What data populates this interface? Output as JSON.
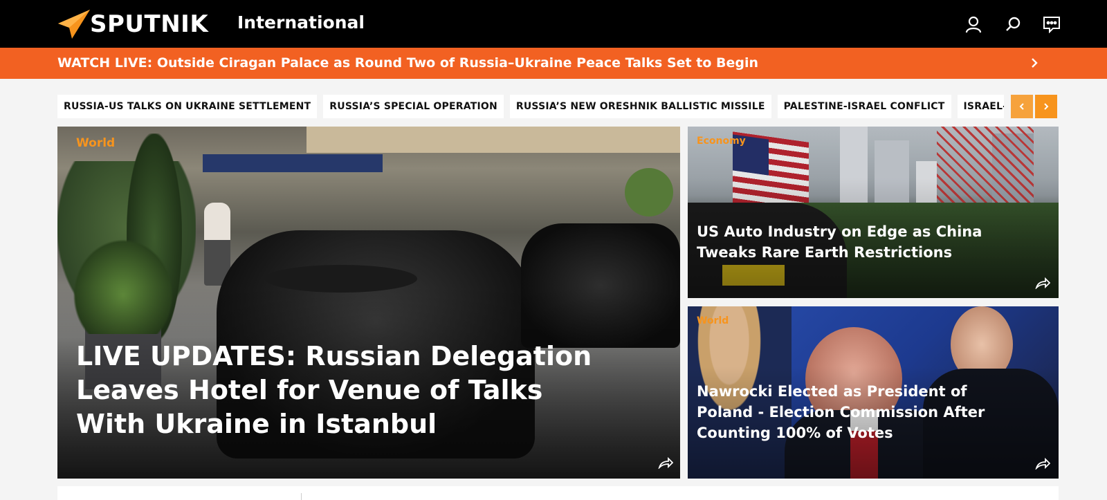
{
  "header": {
    "brand": "SPUTNIK",
    "edition": "International",
    "icons": [
      "user-icon",
      "search-icon",
      "chat-icon"
    ]
  },
  "live": {
    "text": "WATCH LIVE: Outside Ciragan Palace as Round Two of Russia–Ukraine Peace Talks Set to Begin"
  },
  "tags": [
    "RUSSIA-US TALKS ON UKRAINE SETTLEMENT",
    "RUSSIA’S SPECIAL OPERATION",
    "RUSSIA’S NEW ORESHNIK BALLISTIC MISSILE",
    "PALESTINE-ISRAEL CONFLICT",
    "ISRAEL-LEBA"
  ],
  "cards": {
    "main": {
      "category": "World",
      "title": "LIVE UPDATES: Russian Delegation Leaves Hotel for Venue of Talks With Ukraine in Istanbul"
    },
    "top_right": {
      "category": "Economy",
      "title": "US Auto Industry on Edge as China Tweaks Rare Earth Restrictions"
    },
    "bottom_right": {
      "category": "World",
      "title": "Nawrocki Elected as President of Poland - Election Commission After Counting 100% of Votes"
    }
  },
  "colors": {
    "accent_orange": "#f26122",
    "category_orange": "#f7941d",
    "header_black": "#000000"
  }
}
